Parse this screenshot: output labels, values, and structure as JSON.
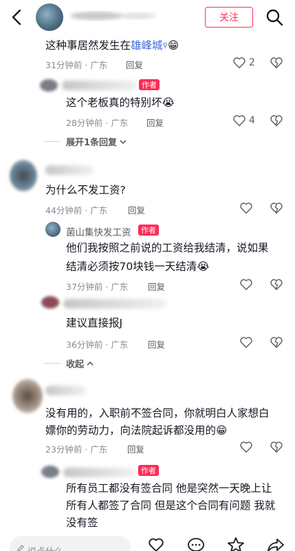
{
  "header": {
    "follow_label": "关注"
  },
  "comments": [
    {
      "text_before_link": "这种事居然发生在",
      "link": "雄峰城",
      "emoji": "😁",
      "meta": "31分钟前 · 广东",
      "reply": "回复",
      "likes": "2"
    },
    {
      "author_badge": "作者",
      "text": "这个老板真的特别坏😭",
      "meta": "28分钟前 · 广东",
      "reply": "回复",
      "likes": "4"
    },
    {
      "expand": "展开1条回复"
    },
    {
      "text": "为什么不发工资?",
      "meta": "44分钟前 · 广东",
      "reply": "回复"
    },
    {
      "author_name": "菌山集快发工资",
      "author_badge": "作者",
      "text_line1": "他们我按照之前说的工资给我结清，说如果",
      "text_line2": "结清必须按70块钱一天结清😭",
      "meta": "37分钟前 · 广东",
      "reply": "回复"
    },
    {
      "text": "建议直接报J",
      "meta": "36分钟前 · 广东",
      "reply": "回复"
    },
    {
      "collapse": "收起"
    },
    {
      "text_line1": "没有用的，入职前不签合同，你就明白人家想白",
      "text_line2": "嫖你的劳动力，向法院起诉都没用的😁",
      "meta": "23分钟前 · 广东",
      "reply": "回复"
    },
    {
      "author_badge": "作者",
      "text_line1": "所有员工都没有签合同 他是突然一天晚上让",
      "text_line2": "所有人都签了合同 但是这个合同有问题 我就",
      "text_line3": "没有签"
    }
  ],
  "bottom": {
    "input_placeholder": "说点什么..."
  },
  "colors": {
    "accent": "#fe2c55",
    "link": "#3a6bd8",
    "meta": "#8a8b91"
  }
}
